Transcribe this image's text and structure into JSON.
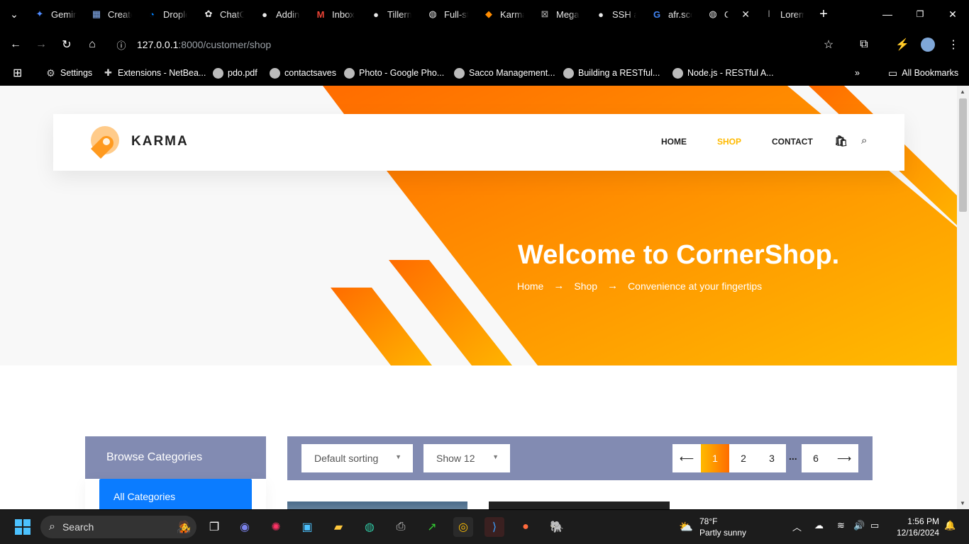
{
  "tabs": [
    {
      "label": "Gemini",
      "icon": "gemini-icon"
    },
    {
      "label": "Create",
      "icon": "chip-icon"
    },
    {
      "label": "Droplet",
      "icon": "digitalocean-icon"
    },
    {
      "label": "ChatGPT",
      "icon": "openai-icon"
    },
    {
      "label": "Adding",
      "icon": "github-icon"
    },
    {
      "label": "Inbox",
      "icon": "gmail-icon"
    },
    {
      "label": "Tillerm",
      "icon": "github-icon"
    },
    {
      "label": "Full-st",
      "icon": "globe-icon"
    },
    {
      "label": "Karma",
      "icon": "karma-icon"
    },
    {
      "label": "Mega",
      "icon": "mega-icon"
    },
    {
      "label": "SSH a",
      "icon": "github-icon"
    },
    {
      "label": "afr.sco",
      "icon": "google-icon"
    },
    {
      "label": "C",
      "icon": "globe-icon",
      "active": true
    },
    {
      "label": "Lorem",
      "icon": "lorem-icon"
    }
  ],
  "address": {
    "host": "127.0.0.1",
    "path": ":8000/customer/shop"
  },
  "bookmarks": [
    {
      "label": "Settings",
      "icon": "gear-icon"
    },
    {
      "label": "Extensions - NetBea...",
      "icon": "puzzle-icon"
    },
    {
      "label": "pdo.pdf",
      "icon": "globe-icon"
    },
    {
      "label": "contactsaves",
      "icon": "globe-icon"
    },
    {
      "label": "Photo - Google Pho...",
      "icon": "globe-icon"
    },
    {
      "label": "Sacco Management...",
      "icon": "globe-icon"
    },
    {
      "label": "Building a RESTful...",
      "icon": "globe-icon"
    },
    {
      "label": "Node.js - RESTful A...",
      "icon": "globe-icon"
    }
  ],
  "all_bookmarks": "All Bookmarks",
  "site": {
    "brand": "KARMA",
    "nav": {
      "home": "HOME",
      "shop": "SHOP",
      "contact": "CONTACT"
    },
    "hero_title": "Welcome to CornerShop.",
    "crumbs": {
      "home": "Home",
      "shop": "Shop",
      "tagline": "Convenience at your fingertips"
    },
    "sidebar": {
      "title": "Browse Categories",
      "all": "All Categories"
    },
    "sorting": "Default sorting",
    "show": "Show 12",
    "pages": {
      "p1": "1",
      "p2": "2",
      "p3": "3",
      "dots": "...",
      "p6": "6"
    }
  },
  "taskbar": {
    "search": "Search",
    "weather_temp": "78°F",
    "weather_desc": "Partly sunny",
    "time": "1:56 PM",
    "date": "12/16/2024"
  },
  "colors": {
    "accent": "#ffba00",
    "accent2": "#ff6c00",
    "panel": "#828bb2",
    "link": "#0b7cff"
  }
}
